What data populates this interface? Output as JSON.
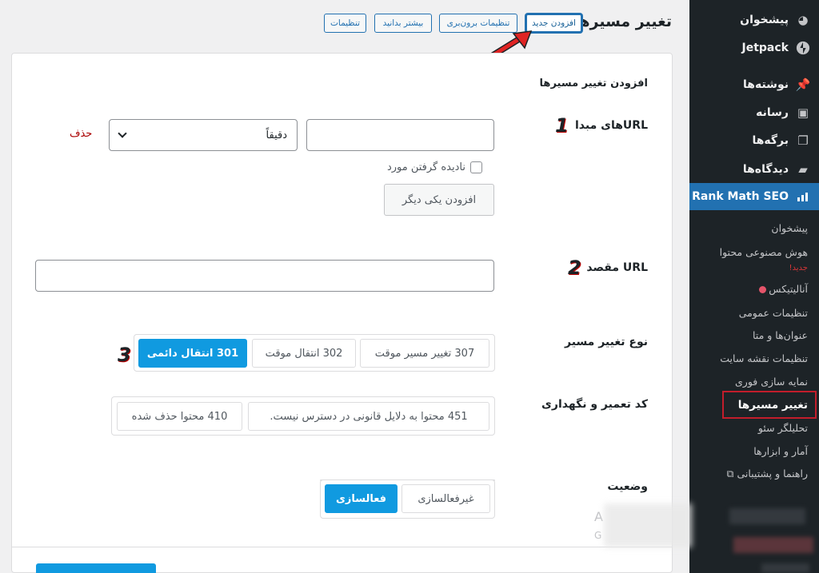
{
  "header": {
    "title": "تغییر مسیرها",
    "buttons": [
      "افزودن جدید",
      "تنظیمات برون‌بری",
      "بیشتر بدانید",
      "تنظیمات"
    ]
  },
  "sidebar": {
    "items": [
      {
        "label": "پیشخوان",
        "icon": "dashboard-icon"
      },
      {
        "label": "Jetpack",
        "icon": "jetpack-icon"
      },
      {
        "label": "نوشته‌ها",
        "icon": "pin-icon"
      },
      {
        "label": "رسانه",
        "icon": "media-icon"
      },
      {
        "label": "برگه‌ها",
        "icon": "pages-icon"
      },
      {
        "label": "دیدگاه‌ها",
        "icon": "comments-icon"
      },
      {
        "label": "Rank Math SEO",
        "icon": "rank-math-icon"
      }
    ],
    "subitems": [
      "پیشخوان",
      "هوش مصنوعی محتوا",
      "آنالیتیکس",
      "تنظیمات عمومی",
      "عنوان‌ها و متا",
      "تنظیمات نقشه سایت",
      "نمایه سازی فوری",
      "تغییر مسیرها",
      "تحلیلگر سئو",
      "آمار و ابزارها",
      "راهنما و پشتیبانی"
    ],
    "new_badge": "جدید!"
  },
  "form": {
    "section_title": "افزودن تغییر مسیرها",
    "source_label": "URLهای مبدا",
    "match_select": "دقیقاً",
    "delete_label": "حذف",
    "ignore_case_label": "نادیده گرفتن مورد",
    "add_another": "افزودن یکی دیگر",
    "destination_label": "URL مقصد",
    "type_label": "نوع تغییر مسیر",
    "type_options": [
      "307 تغییر مسیر موقت",
      "302 انتقال موقت",
      "301 انتقال دائمی"
    ],
    "maintenance_label": "کد تعمیر و نگهداری",
    "maintenance_options": [
      "451 محتوا به دلایل قانونی در دسترس نیست.",
      "410 محتوا حذف شده"
    ],
    "status_label": "وضعیت",
    "status_options": [
      "غیرفعالسازی",
      "فعالسازی"
    ]
  },
  "annotations": {
    "step1": "1",
    "step2": "2",
    "step3": "3"
  },
  "ghost_text": {
    "a": "A",
    "g": "G"
  },
  "colors": {
    "accent": "#109ae0",
    "sidebar": "#1d2327",
    "wp_blue": "#2271b1",
    "highlight": "#c21d2b"
  }
}
